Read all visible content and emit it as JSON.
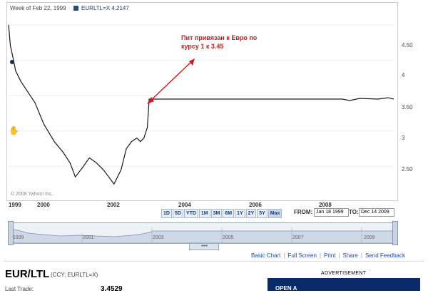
{
  "header": {
    "week": "Week of Feb 22, 1999",
    "legend": "EURLTL=X 4.2147"
  },
  "annotation": {
    "line1": "Пит привязан к Евро по",
    "line2": "курсу 1 к 3.45"
  },
  "copyright": "© 2008 Yahoo! Inc.",
  "chart_data": {
    "type": "line",
    "title": "",
    "xlabel": "",
    "ylabel": "",
    "xlim": [
      1999.0,
      2009.96
    ],
    "ylim": [
      2.05,
      4.75
    ],
    "y_ticks": [
      "4.50",
      "4",
      "3.50",
      "3",
      "2.50"
    ],
    "x_ticks": [
      "1999",
      "2000",
      "2002",
      "2004",
      "2006",
      "2008"
    ],
    "series": [
      {
        "name": "EURLTL=X",
        "x": [
          1999.0,
          1999.05,
          1999.12,
          1999.2,
          1999.35,
          1999.55,
          1999.75,
          2000.0,
          2000.3,
          2000.55,
          2000.75,
          2000.9,
          2001.1,
          2001.3,
          2001.5,
          2001.7,
          2001.85,
          2002.0,
          2002.2,
          2002.35,
          2002.5,
          2002.65,
          2002.75,
          2002.85,
          2002.95,
          2003.0,
          2004.0,
          2005.0,
          2006.0,
          2007.0,
          2007.5,
          2008.0,
          2008.5,
          2008.7,
          2009.0,
          2009.5,
          2009.8,
          2009.96
        ],
        "y": [
          4.5,
          4.21,
          4.05,
          3.85,
          3.7,
          3.55,
          3.4,
          3.1,
          2.85,
          2.7,
          2.55,
          2.35,
          2.48,
          2.62,
          2.55,
          2.45,
          2.35,
          2.25,
          2.45,
          2.75,
          2.85,
          2.9,
          2.85,
          2.9,
          3.05,
          3.45,
          3.45,
          3.45,
          3.45,
          3.45,
          3.45,
          3.45,
          3.45,
          3.43,
          3.46,
          3.45,
          3.47,
          3.45
        ]
      }
    ]
  },
  "range_buttons": [
    "1D",
    "5D",
    "YTD",
    "1M",
    "3M",
    "6M",
    "1Y",
    "2Y",
    "5Y",
    "Max"
  ],
  "range_selected": "Max",
  "date_range": {
    "from_label": "FROM:",
    "from_value": "Jan 18 1999",
    "to_label": "TO:",
    "to_value": "Dec 14 2009"
  },
  "navigator": {
    "years": [
      "1999",
      "2001",
      "2003",
      "2005",
      "2007",
      "2009"
    ],
    "grip": "◂◂◂"
  },
  "footer": {
    "basic_chart": "Basic Chart",
    "full_screen": "Full Screen",
    "print": "Print",
    "share": "Share",
    "send_feedback": "Send Feedback"
  },
  "symbol": {
    "title": "EUR/LTL",
    "ccy": "(CCY: EURLTL=X)"
  },
  "quote": {
    "last_trade_label": "Last Trade:",
    "last_trade_value": "3.4529"
  },
  "ad": {
    "label": "ADVERTISEMENT",
    "text": "OPEN A"
  },
  "colors": {
    "line": "#1a1a1a",
    "accent": "#d31a1a",
    "legend": "#2c4a7a",
    "link": "#1a4bb0"
  },
  "icons": {
    "hand": "hand-pointer-icon"
  }
}
